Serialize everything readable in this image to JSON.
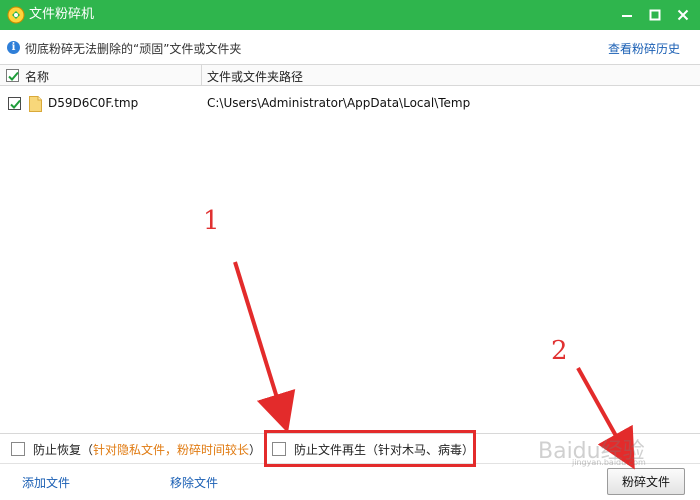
{
  "window": {
    "title": "文件粉碎机",
    "accent_color": "#2fb54d"
  },
  "info": {
    "text": "彻底粉碎无法删除的“顽固”文件或文件夹",
    "history_link": "查看粉碎历史"
  },
  "table": {
    "columns": [
      "名称",
      "文件或文件夹路径"
    ],
    "rows": [
      {
        "name": "D59D6C0F.tmp",
        "path": "C:\\Users\\Administrator\\AppData\\Local\\Temp",
        "checked": true
      }
    ]
  },
  "options": {
    "prevent_recovery_label": "防止恢复（",
    "prevent_recovery_note": "针对隐私文件，粉碎时间较长",
    "prevent_recovery_close": "）",
    "prevent_regen_label": "防止文件再生（针对木马、病毒）"
  },
  "bottom": {
    "add_file": "添加文件",
    "remove_file": "移除文件",
    "shred_button": "粉碎文件"
  },
  "annotations": {
    "marker_1": "1",
    "marker_2": "2",
    "color": "#e32b2b"
  },
  "watermark": {
    "text": "Baidu经验",
    "sub": "jingyan.baidu.com"
  }
}
